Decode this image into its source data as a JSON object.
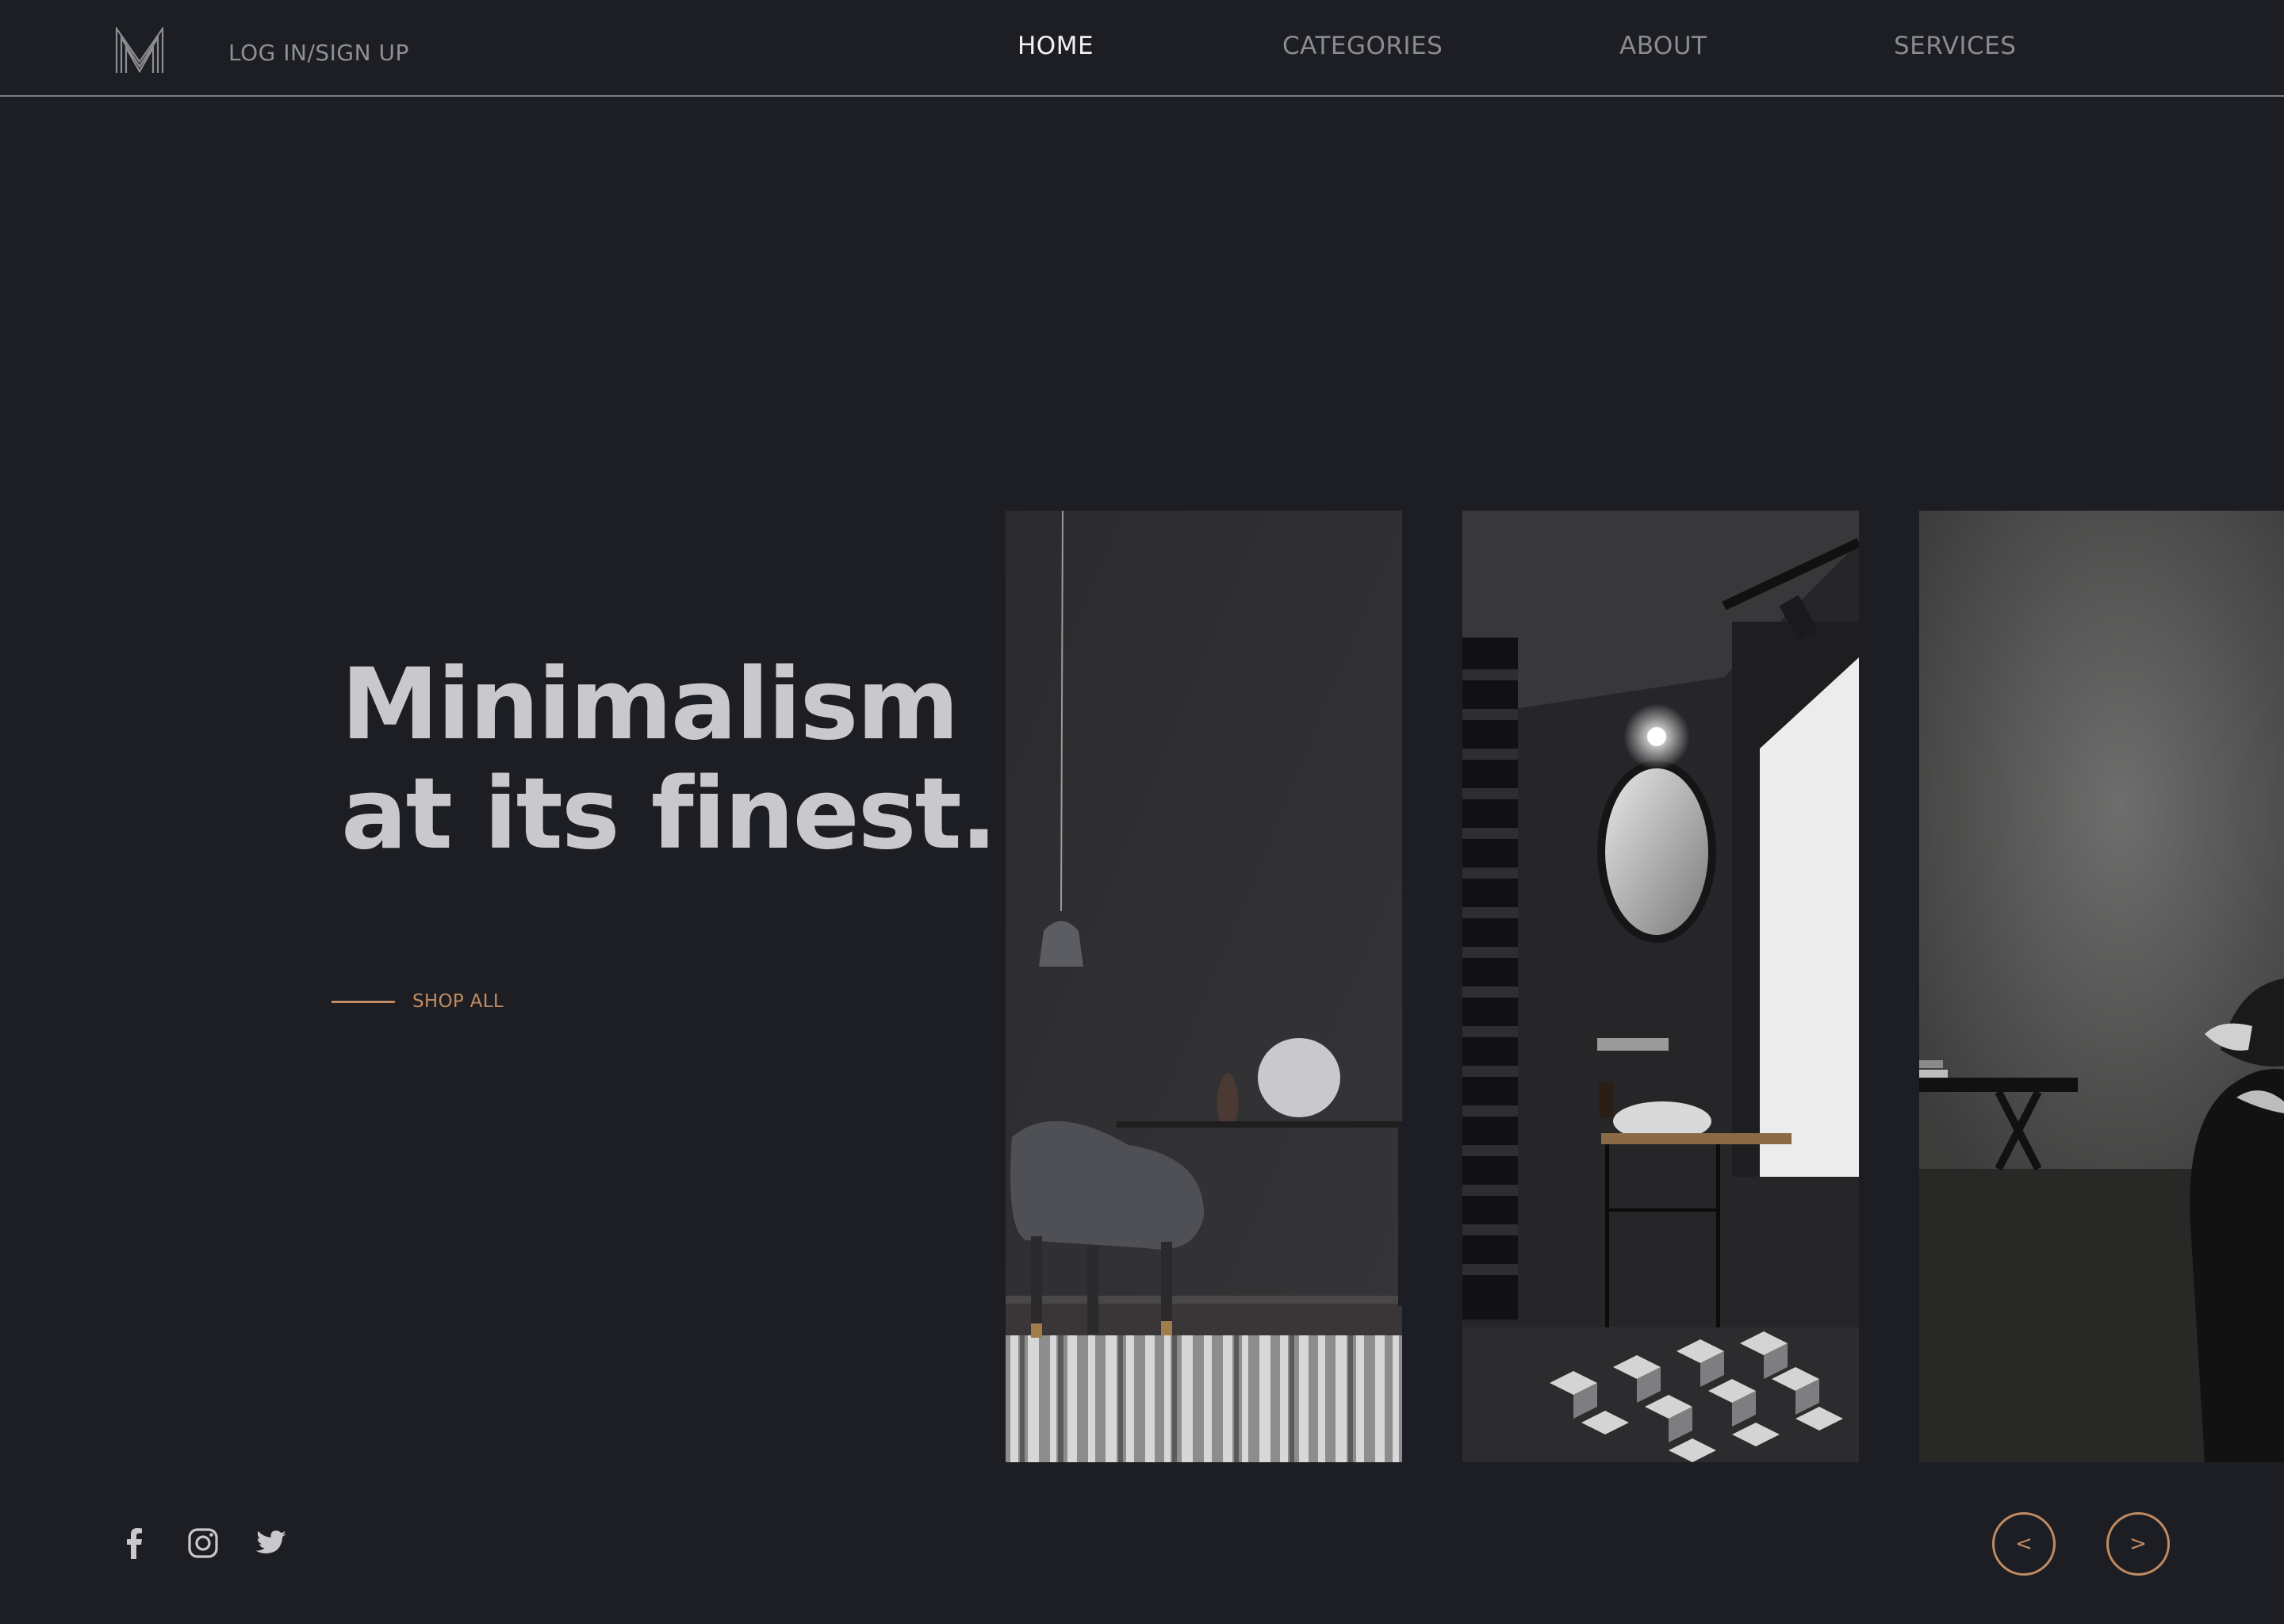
{
  "header": {
    "logo_icon": "m-monogram-logo-icon",
    "login_label": "LOG IN/SIGN UP",
    "nav": [
      {
        "label": "HOME",
        "active": true
      },
      {
        "label": "CATEGORIES",
        "active": false
      },
      {
        "label": "ABOUT",
        "active": false
      },
      {
        "label": "SERVICES",
        "active": false
      }
    ]
  },
  "hero": {
    "title_line1": "Minimalism",
    "title_line2": "at its finest.",
    "shop_label": "SHOP ALL"
  },
  "gallery": {
    "items": [
      {
        "icon": "dark-dining-room-photo"
      },
      {
        "icon": "dark-bathroom-photo"
      },
      {
        "icon": "dark-bedroom-photo"
      }
    ],
    "prev_label": "<",
    "next_label": ">"
  },
  "social": [
    {
      "icon": "facebook-icon"
    },
    {
      "icon": "instagram-icon"
    },
    {
      "icon": "twitter-icon"
    }
  ],
  "colors": {
    "background": "#1d1e23",
    "accent": "#c18b64",
    "nav_active": "#f2f2f2",
    "nav_inactive": "#8a8b90",
    "title": "#c9c9cc"
  }
}
